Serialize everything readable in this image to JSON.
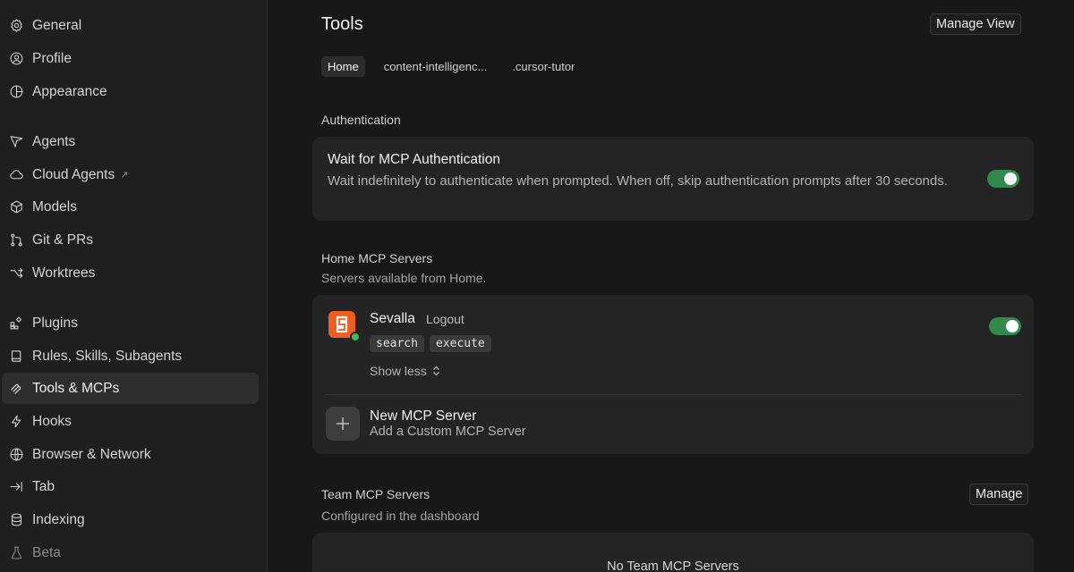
{
  "sidebar": {
    "items": [
      {
        "label": "General",
        "icon": "gear-icon"
      },
      {
        "label": "Profile",
        "icon": "user-circle-icon"
      },
      {
        "label": "Appearance",
        "icon": "palette-icon"
      },
      {
        "label": "Agents",
        "icon": "send-arrow-icon"
      },
      {
        "label": "Cloud Agents",
        "icon": "cloud-icon",
        "external": "↗"
      },
      {
        "label": "Models",
        "icon": "cube-icon"
      },
      {
        "label": "Git & PRs",
        "icon": "git-branch-icon"
      },
      {
        "label": "Worktrees",
        "icon": "worktree-icon"
      },
      {
        "label": "Plugins",
        "icon": "plugin-icon"
      },
      {
        "label": "Rules, Skills, Subagents",
        "icon": "book-icon"
      },
      {
        "label": "Tools & MCPs",
        "icon": "tools-icon"
      },
      {
        "label": "Hooks",
        "icon": "bolt-icon"
      },
      {
        "label": "Browser & Network",
        "icon": "globe-icon"
      },
      {
        "label": "Tab",
        "icon": "tab-arrow-icon"
      },
      {
        "label": "Indexing",
        "icon": "database-icon"
      },
      {
        "label": "Beta",
        "icon": "flask-icon"
      }
    ],
    "active": "Tools & MCPs"
  },
  "header": {
    "title": "Tools",
    "manage_view_label": "Manage View"
  },
  "tabs": [
    {
      "label": "Home",
      "active": true
    },
    {
      "label": "content-intelligenc...",
      "active": false
    },
    {
      "label": ".cursor-tutor",
      "active": false
    }
  ],
  "authentication": {
    "section_label": "Authentication",
    "title": "Wait for MCP Authentication",
    "description": "Wait indefinitely to authenticate when prompted. When off, skip authentication prompts after 30 seconds.",
    "toggle_on": true
  },
  "home_servers": {
    "section_label": "Home MCP Servers",
    "section_sub": "Servers available from Home.",
    "server": {
      "name": "Sevalla",
      "logout_label": "Logout",
      "tools": [
        "search",
        "execute"
      ],
      "show_less_label": "Show less",
      "toggle_on": true,
      "status_color": "#3fb950",
      "logo_color": "#f25c1f"
    },
    "new_server": {
      "title": "New MCP Server",
      "subtitle": "Add a Custom MCP Server",
      "icon": "plus-icon"
    }
  },
  "team_servers": {
    "section_label": "Team MCP Servers",
    "section_sub": "Configured in the dashboard",
    "manage_label": "Manage",
    "empty_label": "No Team MCP Servers"
  },
  "colors": {
    "toggle_on": "#2f8a4c",
    "background": "#181818",
    "sidebar": "#1f1f1f",
    "card": "#242424"
  }
}
